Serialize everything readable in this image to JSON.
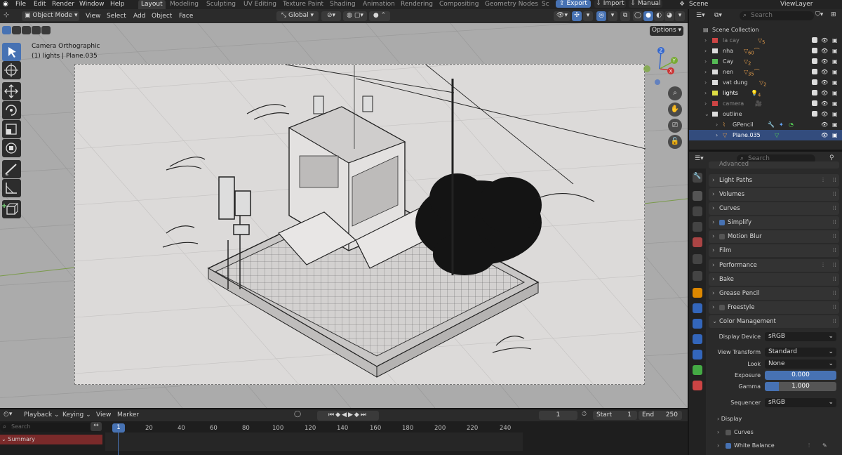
{
  "menu": {
    "file": "File",
    "edit": "Edit",
    "render": "Render",
    "window": "Window",
    "help": "Help"
  },
  "workspaces": [
    "Layout",
    "Modeling",
    "Sculpting",
    "UV Editing",
    "Texture Paint",
    "Shading",
    "Animation",
    "Rendering",
    "Compositing",
    "Geometry Nodes",
    "Sc"
  ],
  "topbar_right": {
    "export": "Export",
    "import": "Import",
    "manual": "Manual",
    "scene": "Scene",
    "view_layer": "ViewLayer"
  },
  "viewport_header": {
    "mode": "Object Mode",
    "view": "View",
    "select": "Select",
    "add": "Add",
    "object": "Object",
    "face": "Face",
    "orientation": "Global",
    "options": "Options"
  },
  "viewport": {
    "camera_label": "Camera Orthographic",
    "selection_label": "(1) lights | Plane.035"
  },
  "outliner": {
    "search_placeholder": "Search",
    "collection": "Scene Collection",
    "rows": [
      {
        "name": "la cay",
        "badge": "5"
      },
      {
        "name": "nha",
        "badge": "60"
      },
      {
        "name": "Cay",
        "badge": "2"
      },
      {
        "name": "nen",
        "badge": "35"
      },
      {
        "name": "vat dung",
        "badge": "2"
      },
      {
        "name": "lights",
        "badge": "4"
      },
      {
        "name": "camera",
        "badge": ""
      },
      {
        "name": "outline",
        "badge": ""
      },
      {
        "name": "GPencil",
        "badge": ""
      },
      {
        "name": "Plane.035",
        "badge": ""
      }
    ]
  },
  "properties": {
    "search_placeholder": "Search",
    "advanced": "Advanced",
    "panels": [
      {
        "label": "Light Paths",
        "checkbox": false
      },
      {
        "label": "Volumes",
        "checkbox": false
      },
      {
        "label": "Curves",
        "checkbox": false
      },
      {
        "label": "Simplify",
        "checkbox": true
      },
      {
        "label": "Motion Blur",
        "checkbox": false
      },
      {
        "label": "Film",
        "checkbox": false
      },
      {
        "label": "Performance",
        "checkbox": false
      },
      {
        "label": "Bake",
        "checkbox": false
      },
      {
        "label": "Grease Pencil",
        "checkbox": false
      },
      {
        "label": "Freestyle",
        "checkbox": false
      },
      {
        "label": "Color Management",
        "checkbox": false
      }
    ],
    "color_management": {
      "display_device_label": "Display Device",
      "display_device": "sRGB",
      "view_transform_label": "View Transform",
      "view_transform": "Standard",
      "look_label": "Look",
      "look": "None",
      "exposure_label": "Exposure",
      "exposure": "0.000",
      "gamma_label": "Gamma",
      "gamma": "1.000",
      "sequencer_label": "Sequencer",
      "sequencer": "sRGB"
    },
    "subpanels": {
      "display": "Display",
      "curves": "Curves",
      "white_balance": "White Balance"
    }
  },
  "timeline": {
    "playback": "Playback",
    "keying": "Keying",
    "view": "View",
    "marker": "Marker",
    "current_frame": "1",
    "start_label": "Start",
    "start": "1",
    "end_label": "End",
    "end": "250",
    "search_placeholder": "Search",
    "summary": "Summary",
    "ticks": [
      "1",
      "20",
      "40",
      "60",
      "80",
      "100",
      "120",
      "140",
      "160",
      "180",
      "200",
      "220",
      "240"
    ]
  },
  "colors": {
    "accent": "#4772b3",
    "selection": "#334c7d",
    "summary_bg": "#7a2a2a"
  }
}
